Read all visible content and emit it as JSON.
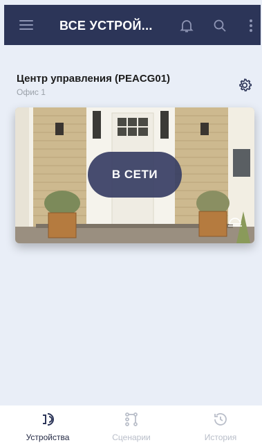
{
  "header": {
    "title": "ВСЕ УСТРОЙ..."
  },
  "hub": {
    "name": "Центр управления (PEACG01)",
    "location": "Офис 1",
    "status": "В СЕТИ"
  },
  "tabs": [
    {
      "label": "Устройства",
      "icon": "devices-icon",
      "active": true
    },
    {
      "label": "Сценарии",
      "icon": "scenarios-icon",
      "active": false
    },
    {
      "label": "История",
      "icon": "history-icon",
      "active": false
    }
  ],
  "colors": {
    "header_bg": "#2c3558",
    "accent": "#2c3558",
    "background": "#e9eef7",
    "inactive": "#b9bec9"
  }
}
